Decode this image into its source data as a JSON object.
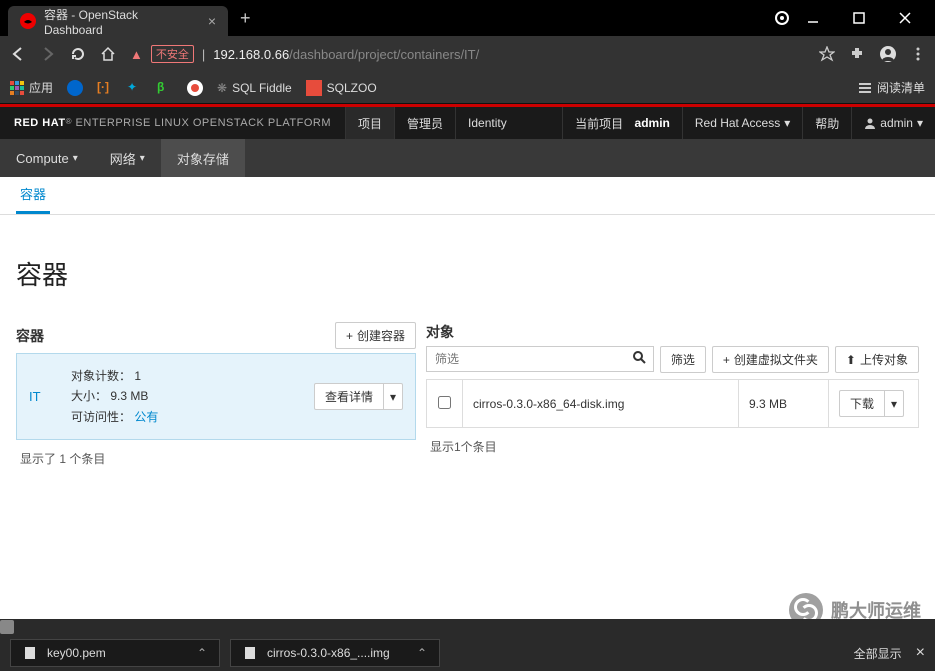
{
  "browser": {
    "tab_title": "容器 - OpenStack Dashboard",
    "url_unsafe": "不安全",
    "url_host": "192.168.0.66",
    "url_path": "/dashboard/project/containers/IT/",
    "bookmarks": {
      "apps": "应用",
      "sql_fiddle": "SQL Fiddle",
      "sqlzoo": "SQLZOO",
      "reading_list": "阅读清单"
    }
  },
  "header": {
    "brand_bold": "RED HAT",
    "brand_rest": " ENTERPRISE LINUX OPENSTACK PLATFORM",
    "nav": {
      "project": "项目",
      "admin": "管理员",
      "identity": "Identity"
    },
    "current_project_label": "当前项目",
    "current_project_value": "admin",
    "redhat_access": "Red Hat Access",
    "help": "帮助",
    "user": "admin"
  },
  "subnav": {
    "compute": "Compute",
    "network": "网络",
    "object_storage": "对象存储"
  },
  "page": {
    "tab": "容器",
    "title": "容器"
  },
  "containers": {
    "panel_title": "容器",
    "create_btn": "创建容器",
    "selected": {
      "name": "IT",
      "count_label": "对象计数：",
      "count_value": "1",
      "size_label": "大小：",
      "size_value": "9.3 MB",
      "access_label": "可访问性：",
      "access_value": "公有"
    },
    "details_btn": "查看详情",
    "summary": "显示了 1 个条目"
  },
  "objects": {
    "panel_title": "对象",
    "filter_placeholder": "筛选",
    "filter_btn": "筛选",
    "create_folder_btn": "创建虚拟文件夹",
    "upload_btn": "上传对象",
    "rows": [
      {
        "name": "cirros-0.3.0-x86_64-disk.img",
        "size": "9.3 MB",
        "action": "下载"
      }
    ],
    "summary": "显示1个条目"
  },
  "downloads": {
    "items": [
      {
        "name": "key00.pem"
      },
      {
        "name": "cirros-0.3.0-x86_....img"
      }
    ],
    "show_all": "全部显示"
  },
  "watermark": "鹏大师运维"
}
